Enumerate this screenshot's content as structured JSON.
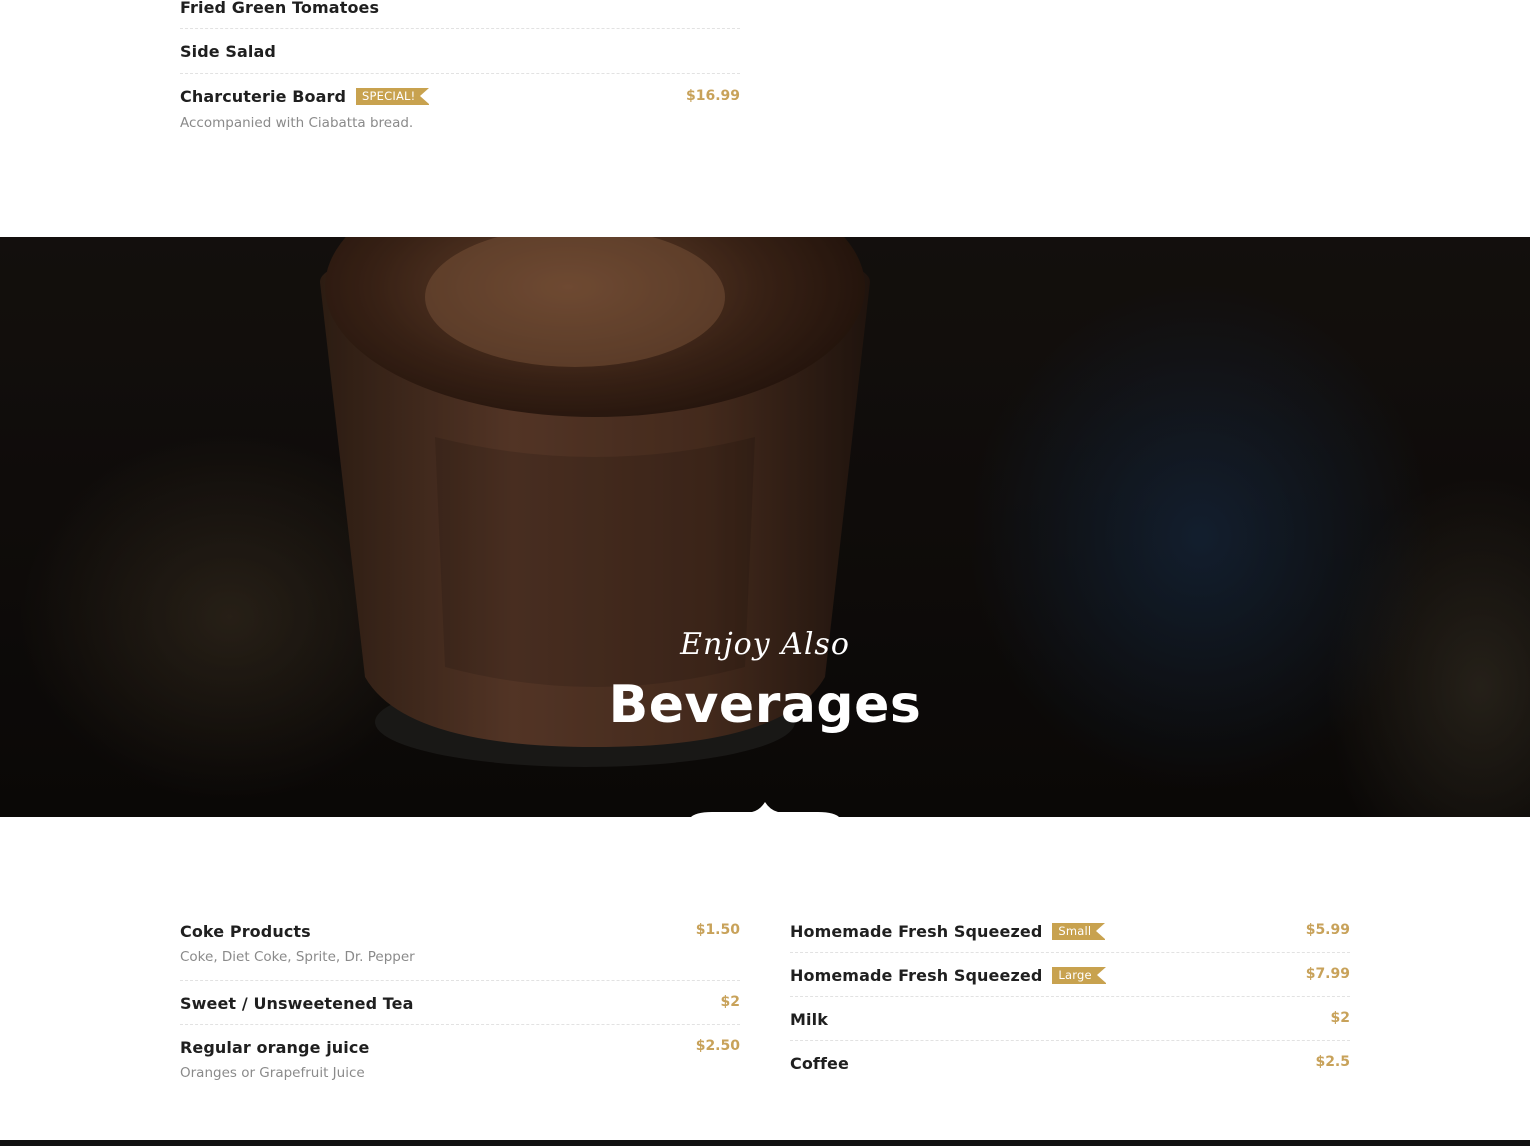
{
  "starters": {
    "items": [
      {
        "title": "Fried Green Tomatoes"
      },
      {
        "title": "Side Salad"
      },
      {
        "title": "Charcuterie Board",
        "badge": "SPECIAL!",
        "price": "$16.99",
        "desc": "Accompanied with Ciabatta bread."
      }
    ]
  },
  "hero": {
    "subtitle": "Enjoy Also",
    "title": "Beverages"
  },
  "beverages_left": {
    "items": [
      {
        "title": "Coke Products",
        "price": "$1.50",
        "desc": "Coke, Diet Coke, Sprite, Dr. Pepper"
      },
      {
        "title": "Sweet / Unsweetened Tea",
        "price": "$2"
      },
      {
        "title": "Regular orange juice",
        "price": "$2.50",
        "desc": "Oranges or Grapefruit Juice"
      }
    ]
  },
  "beverages_right": {
    "items": [
      {
        "title": "Homemade Fresh Squeezed",
        "badge": "Small",
        "price": "$5.99"
      },
      {
        "title": "Homemade Fresh Squeezed",
        "badge": "Large",
        "price": "$7.99"
      },
      {
        "title": "Milk",
        "price": "$2"
      },
      {
        "title": "Coffee",
        "price": "$2.5"
      }
    ]
  },
  "colors": {
    "accent": "#c8a24f",
    "title": "#1f1f1f",
    "desc": "#8a8a8a"
  }
}
